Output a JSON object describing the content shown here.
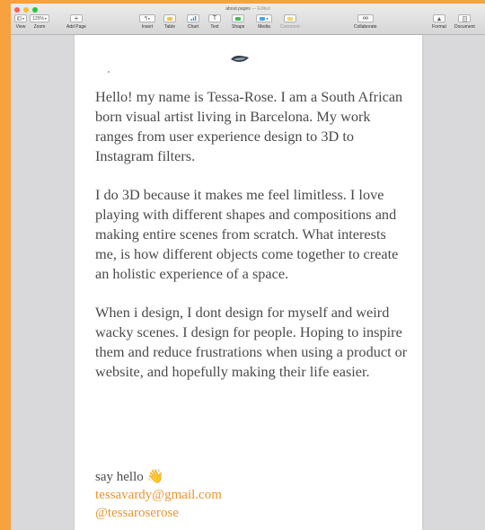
{
  "window": {
    "title": "about.pages",
    "edited_label": "— Edited"
  },
  "toolbar": {
    "view": {
      "label": "View",
      "icon": "sidebar-icon"
    },
    "zoom": {
      "label": "Zoom",
      "value": "125%"
    },
    "add_page": {
      "label": "Add Page",
      "icon": "plus-icon"
    },
    "insert": {
      "label": "Insert",
      "icon": "paragraph-icon"
    },
    "table": {
      "label": "Table",
      "icon": "table-icon"
    },
    "chart": {
      "label": "Chart",
      "icon": "chart-icon"
    },
    "text": {
      "label": "Text",
      "icon": "text-box-icon"
    },
    "shape": {
      "label": "Shape",
      "icon": "shape-icon"
    },
    "media": {
      "label": "Media",
      "icon": "media-icon"
    },
    "comment": {
      "label": "Comment",
      "icon": "comment-icon"
    },
    "collaborate": {
      "label": "Collaborate",
      "icon": "collaborate-icon"
    },
    "format": {
      "label": "Format",
      "icon": "paintbrush-icon"
    },
    "document": {
      "label": "Document",
      "icon": "document-icon"
    }
  },
  "document": {
    "paragraphs": [
      "Hello! my name is Tessa-Rose. I am a South African born visual artist living in Barcelona. My work ranges from user experience design to 3D to Instagram filters.",
      "I do 3D because it makes me feel limitless. I love playing with different shapes and compositions and making entire scenes from scratch. What interests me, is how different objects come together to create an holistic experience of a space.",
      "When i design, I dont design for myself and weird wacky scenes. I design for people. Hoping to inspire them and reduce frustrations when using a product or website, and hopefully making their life easier."
    ],
    "say_hello": "say hello",
    "wave_emoji": "👋",
    "email": "tessavardy@gmail.com",
    "handle": "@tessaroserose"
  },
  "colors": {
    "background": "#f7a23f",
    "link": "#e8952c",
    "body_text": "#4a4a4a"
  }
}
